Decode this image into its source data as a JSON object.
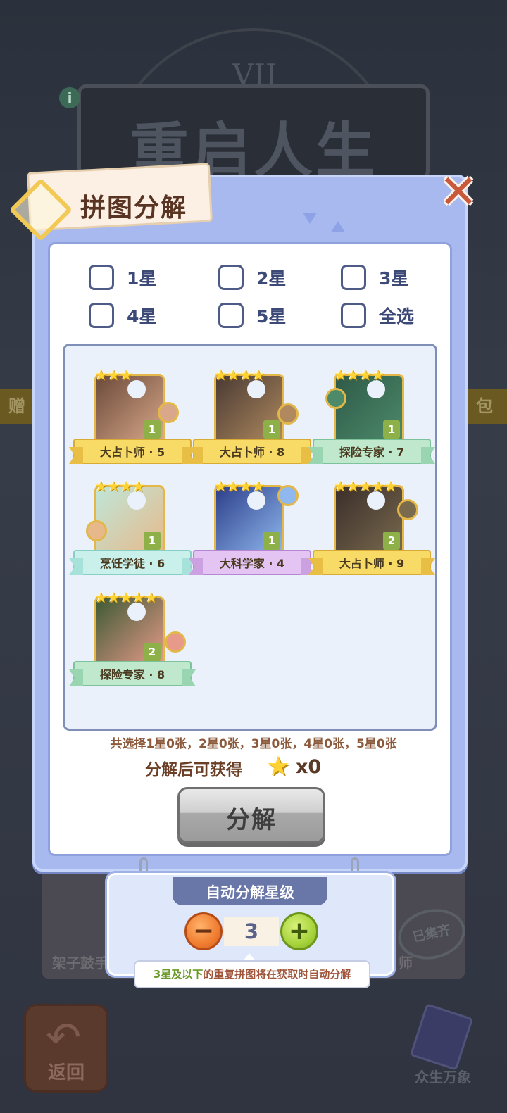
{
  "background": {
    "title": "重启人生",
    "numeral": "VII",
    "info_icon": "i",
    "left_banner": "赠",
    "right_banner": "包",
    "card_label": "架子鼓手",
    "card_label_right": "师",
    "stamp": "已集齐",
    "back_label": "返回",
    "codex_label": "众生万象"
  },
  "dialog": {
    "title": "拼图分解",
    "close_glyph": "✕"
  },
  "filters": [
    {
      "label": "1星"
    },
    {
      "label": "2星"
    },
    {
      "label": "3星"
    },
    {
      "label": "4星"
    },
    {
      "label": "5星"
    },
    {
      "label": "全选"
    }
  ],
  "pieces": [
    {
      "name": "大占卜师 · 5",
      "stars": "★★★",
      "count": "1",
      "ribbon": "gold",
      "art": [
        "#6b4a3a",
        "#d9a88a"
      ]
    },
    {
      "name": "大占卜师 · 8",
      "stars": "★★★★",
      "count": "1",
      "ribbon": "gold",
      "art": [
        "#4a3a34",
        "#b08a5e"
      ]
    },
    {
      "name": "探险专家 · 7",
      "stars": "★★★★",
      "count": "1",
      "ribbon": "green",
      "art": [
        "#2f5a48",
        "#4c8a6a"
      ]
    },
    {
      "name": "烹饪学徒 · 6",
      "stars": "★★★★",
      "count": "1",
      "ribbon": "teal",
      "art": [
        "#bfe6d8",
        "#e7b98a"
      ]
    },
    {
      "name": "大科学家 · 4",
      "stars": "★★★★",
      "count": "1",
      "ribbon": "purple",
      "art": [
        "#2d3f8a",
        "#8fb8ee"
      ]
    },
    {
      "name": "大占卜师 · 9",
      "stars": "★★★★★",
      "count": "2",
      "ribbon": "gold",
      "art": [
        "#3a2e2a",
        "#7a6a4e"
      ]
    },
    {
      "name": "探险专家 · 8",
      "stars": "★★★★★",
      "count": "2",
      "ribbon": "green",
      "art": [
        "#3e5a34",
        "#e79a8a"
      ]
    }
  ],
  "colors": {
    "ribbon_gold": "#f8da66",
    "ribbon_green": "#bfe8cc",
    "ribbon_teal": "#c9f0ea",
    "ribbon_purple": "#e3c4f2",
    "panel": "#a8b9ef"
  },
  "summary": "共选择1星0张，2星0张，3星0张，4星0张，5星0张",
  "reward": {
    "label": "分解后可获得",
    "star_icon": "★",
    "count": "x0"
  },
  "decompose_button": "分解",
  "auto": {
    "title": "自动分解星级",
    "minus": "−",
    "plus": "+",
    "level": "3",
    "tip_highlight": "3星及以下",
    "tip_rest": "的重复拼图将在获取时自动分解"
  }
}
